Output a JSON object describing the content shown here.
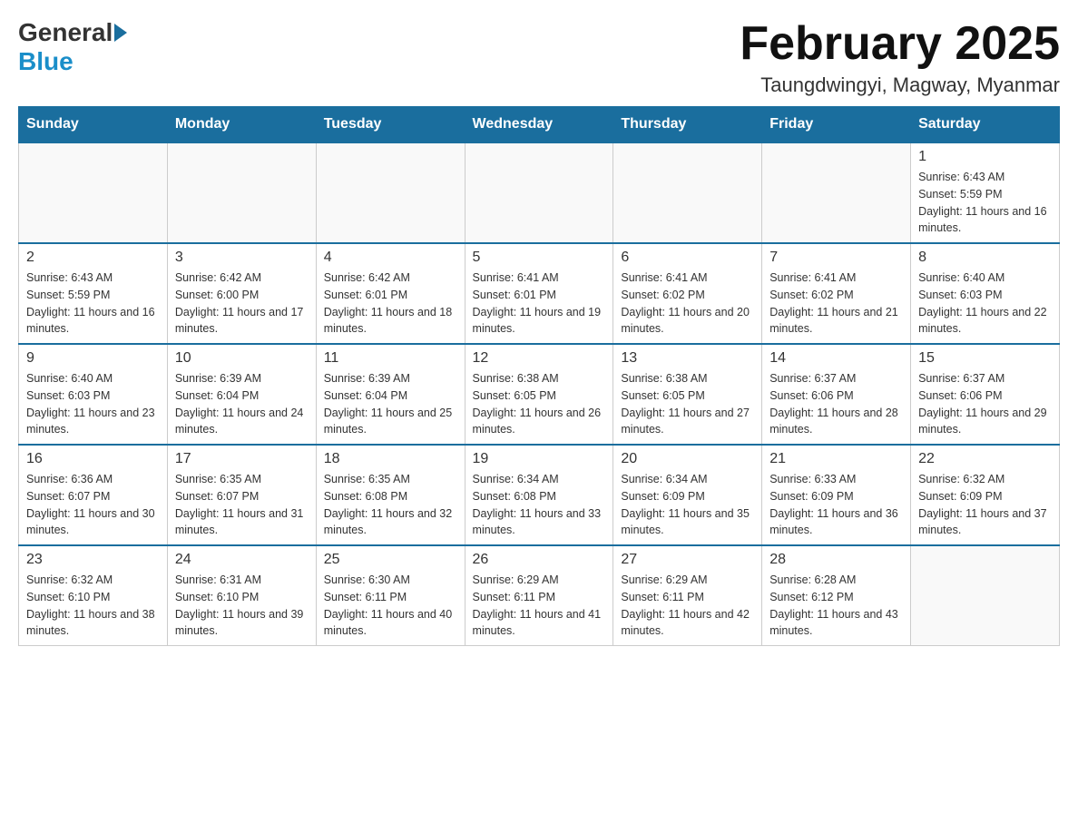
{
  "header": {
    "logo": {
      "general": "General",
      "blue": "Blue"
    },
    "title": "February 2025",
    "location": "Taungdwingyi, Magway, Myanmar"
  },
  "days_of_week": [
    "Sunday",
    "Monday",
    "Tuesday",
    "Wednesday",
    "Thursday",
    "Friday",
    "Saturday"
  ],
  "weeks": [
    [
      {
        "day": "",
        "info": ""
      },
      {
        "day": "",
        "info": ""
      },
      {
        "day": "",
        "info": ""
      },
      {
        "day": "",
        "info": ""
      },
      {
        "day": "",
        "info": ""
      },
      {
        "day": "",
        "info": ""
      },
      {
        "day": "1",
        "info": "Sunrise: 6:43 AM\nSunset: 5:59 PM\nDaylight: 11 hours and 16 minutes."
      }
    ],
    [
      {
        "day": "2",
        "info": "Sunrise: 6:43 AM\nSunset: 5:59 PM\nDaylight: 11 hours and 16 minutes."
      },
      {
        "day": "3",
        "info": "Sunrise: 6:42 AM\nSunset: 6:00 PM\nDaylight: 11 hours and 17 minutes."
      },
      {
        "day": "4",
        "info": "Sunrise: 6:42 AM\nSunset: 6:01 PM\nDaylight: 11 hours and 18 minutes."
      },
      {
        "day": "5",
        "info": "Sunrise: 6:41 AM\nSunset: 6:01 PM\nDaylight: 11 hours and 19 minutes."
      },
      {
        "day": "6",
        "info": "Sunrise: 6:41 AM\nSunset: 6:02 PM\nDaylight: 11 hours and 20 minutes."
      },
      {
        "day": "7",
        "info": "Sunrise: 6:41 AM\nSunset: 6:02 PM\nDaylight: 11 hours and 21 minutes."
      },
      {
        "day": "8",
        "info": "Sunrise: 6:40 AM\nSunset: 6:03 PM\nDaylight: 11 hours and 22 minutes."
      }
    ],
    [
      {
        "day": "9",
        "info": "Sunrise: 6:40 AM\nSunset: 6:03 PM\nDaylight: 11 hours and 23 minutes."
      },
      {
        "day": "10",
        "info": "Sunrise: 6:39 AM\nSunset: 6:04 PM\nDaylight: 11 hours and 24 minutes."
      },
      {
        "day": "11",
        "info": "Sunrise: 6:39 AM\nSunset: 6:04 PM\nDaylight: 11 hours and 25 minutes."
      },
      {
        "day": "12",
        "info": "Sunrise: 6:38 AM\nSunset: 6:05 PM\nDaylight: 11 hours and 26 minutes."
      },
      {
        "day": "13",
        "info": "Sunrise: 6:38 AM\nSunset: 6:05 PM\nDaylight: 11 hours and 27 minutes."
      },
      {
        "day": "14",
        "info": "Sunrise: 6:37 AM\nSunset: 6:06 PM\nDaylight: 11 hours and 28 minutes."
      },
      {
        "day": "15",
        "info": "Sunrise: 6:37 AM\nSunset: 6:06 PM\nDaylight: 11 hours and 29 minutes."
      }
    ],
    [
      {
        "day": "16",
        "info": "Sunrise: 6:36 AM\nSunset: 6:07 PM\nDaylight: 11 hours and 30 minutes."
      },
      {
        "day": "17",
        "info": "Sunrise: 6:35 AM\nSunset: 6:07 PM\nDaylight: 11 hours and 31 minutes."
      },
      {
        "day": "18",
        "info": "Sunrise: 6:35 AM\nSunset: 6:08 PM\nDaylight: 11 hours and 32 minutes."
      },
      {
        "day": "19",
        "info": "Sunrise: 6:34 AM\nSunset: 6:08 PM\nDaylight: 11 hours and 33 minutes."
      },
      {
        "day": "20",
        "info": "Sunrise: 6:34 AM\nSunset: 6:09 PM\nDaylight: 11 hours and 35 minutes."
      },
      {
        "day": "21",
        "info": "Sunrise: 6:33 AM\nSunset: 6:09 PM\nDaylight: 11 hours and 36 minutes."
      },
      {
        "day": "22",
        "info": "Sunrise: 6:32 AM\nSunset: 6:09 PM\nDaylight: 11 hours and 37 minutes."
      }
    ],
    [
      {
        "day": "23",
        "info": "Sunrise: 6:32 AM\nSunset: 6:10 PM\nDaylight: 11 hours and 38 minutes."
      },
      {
        "day": "24",
        "info": "Sunrise: 6:31 AM\nSunset: 6:10 PM\nDaylight: 11 hours and 39 minutes."
      },
      {
        "day": "25",
        "info": "Sunrise: 6:30 AM\nSunset: 6:11 PM\nDaylight: 11 hours and 40 minutes."
      },
      {
        "day": "26",
        "info": "Sunrise: 6:29 AM\nSunset: 6:11 PM\nDaylight: 11 hours and 41 minutes."
      },
      {
        "day": "27",
        "info": "Sunrise: 6:29 AM\nSunset: 6:11 PM\nDaylight: 11 hours and 42 minutes."
      },
      {
        "day": "28",
        "info": "Sunrise: 6:28 AM\nSunset: 6:12 PM\nDaylight: 11 hours and 43 minutes."
      },
      {
        "day": "",
        "info": ""
      }
    ]
  ]
}
